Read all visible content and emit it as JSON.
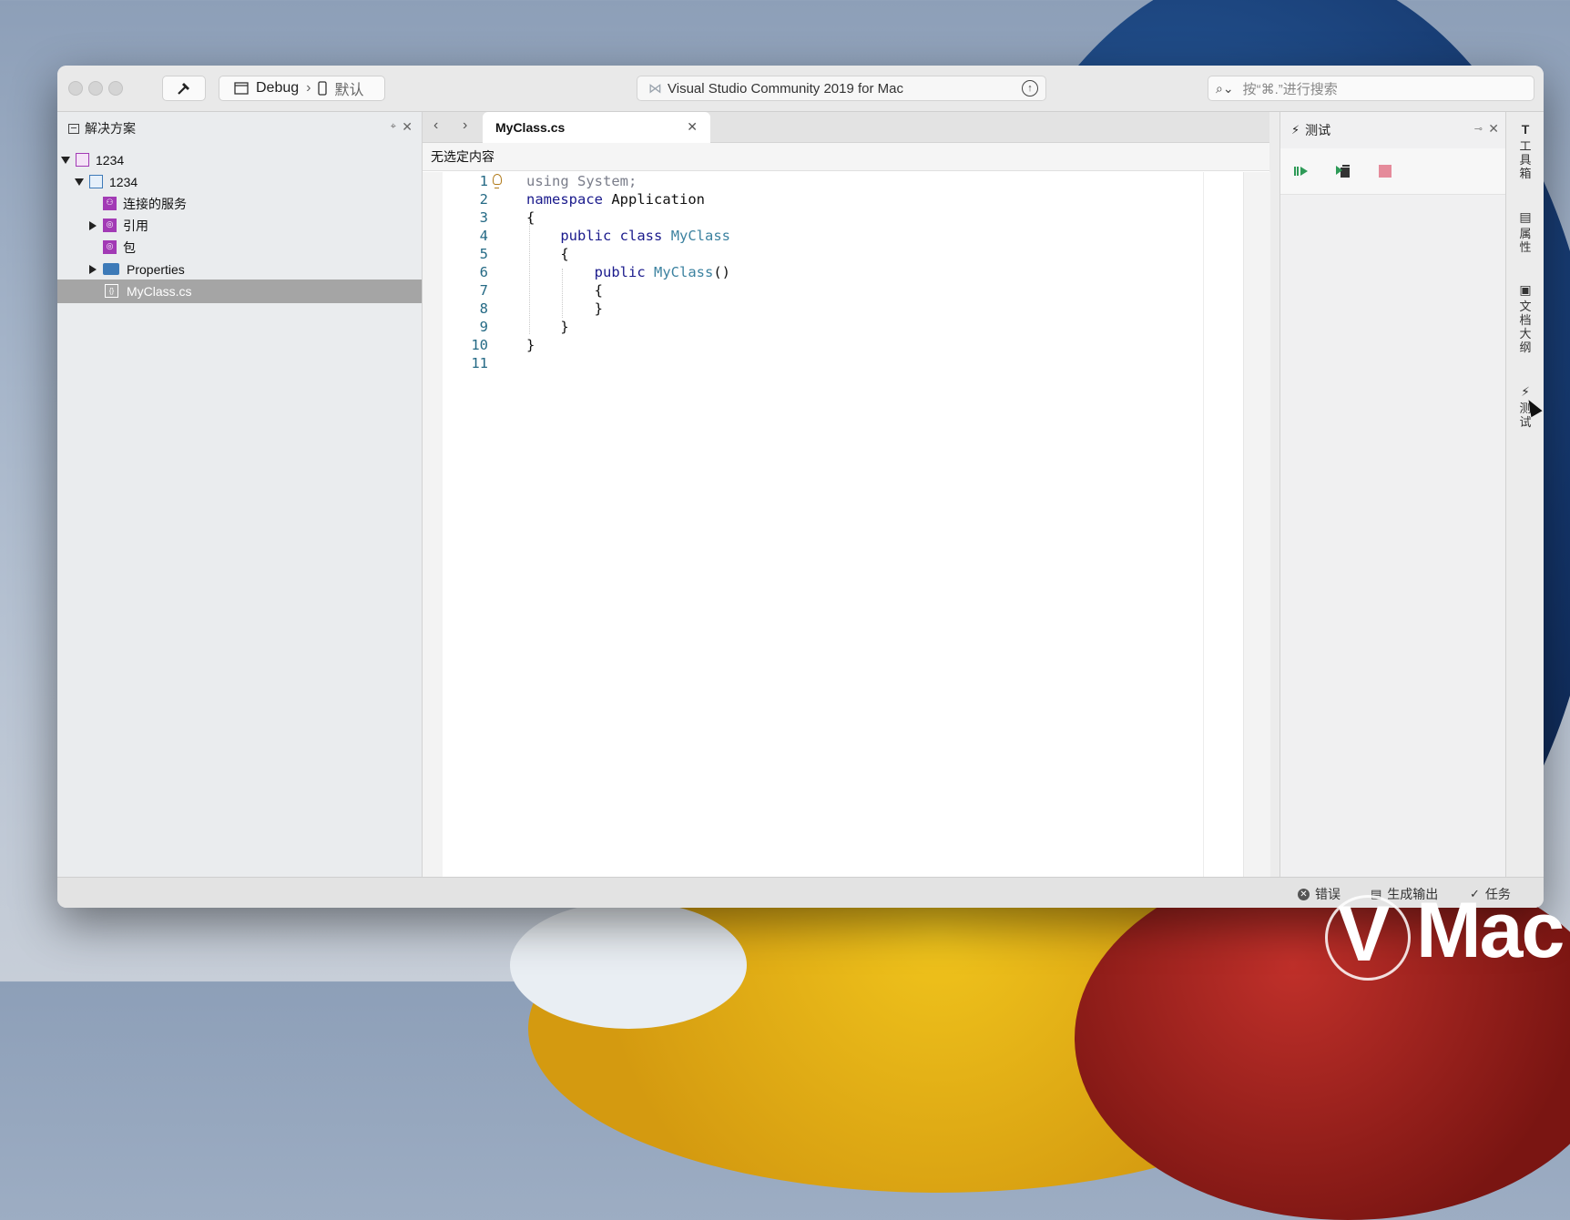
{
  "window": {
    "title_field": "Visual Studio Community 2019 for Mac",
    "config": "Debug",
    "config_separator": "›",
    "device": "默认",
    "search_placeholder": "按“⌘.”进行搜索"
  },
  "solution_pane": {
    "title": "解决方案",
    "items": [
      {
        "label": "1234",
        "icon": "solution-icon"
      },
      {
        "label": "1234",
        "icon": "project-icon"
      },
      {
        "label": "连接的服务",
        "icon": "connected-services-icon"
      },
      {
        "label": "引用",
        "icon": "references-icon"
      },
      {
        "label": "包",
        "icon": "packages-icon"
      },
      {
        "label": "Properties",
        "icon": "folder-icon"
      },
      {
        "label": "MyClass.cs",
        "icon": "cs-file-icon"
      }
    ]
  },
  "editor": {
    "tab_label": "MyClass.cs",
    "breadcrumb": "无选定内容",
    "lines": [
      {
        "n": "1",
        "text": "using System;"
      },
      {
        "n": "2",
        "text": "namespace Application"
      },
      {
        "n": "3",
        "text": "{"
      },
      {
        "n": "4",
        "text": "    public class MyClass"
      },
      {
        "n": "5",
        "text": "    {"
      },
      {
        "n": "6",
        "text": "        public MyClass()"
      },
      {
        "n": "7",
        "text": "        {"
      },
      {
        "n": "8",
        "text": "        }"
      },
      {
        "n": "9",
        "text": "    }"
      },
      {
        "n": "10",
        "text": "}"
      },
      {
        "n": "11",
        "text": ""
      }
    ],
    "tokens": {
      "using": "using",
      "system": "System;",
      "namespace": "namespace",
      "app": "Application",
      "public": "public",
      "class": "class",
      "myclass": "MyClass",
      "ctor_parens": "()",
      "open_brace": "{",
      "close_brace": "}"
    }
  },
  "test_pane": {
    "title": "测试",
    "tools": [
      "run-tests-icon",
      "run-selected-icon",
      "stop-icon"
    ]
  },
  "side_strip": {
    "items": [
      {
        "label": "工具箱",
        "icon": "toolbox-icon"
      },
      {
        "label": "属性",
        "icon": "properties-icon"
      },
      {
        "label": "文档大纲",
        "icon": "outline-icon"
      },
      {
        "label": "测试",
        "icon": "test-icon"
      }
    ]
  },
  "statusbar": {
    "errors": "错误",
    "build_output": "生成输出",
    "tasks": "任务"
  },
  "watermark": {
    "text": "Mac"
  },
  "colors": {
    "keyword": "#1a1a8c",
    "type": "#3c82a0",
    "line_number": "#256a85",
    "selection": "#a5a5a5",
    "project_purple": "#a23ab5",
    "folder_blue": "#3d7ab8",
    "run_green": "#2e9a57",
    "stop_pink": "#e58b9b"
  }
}
